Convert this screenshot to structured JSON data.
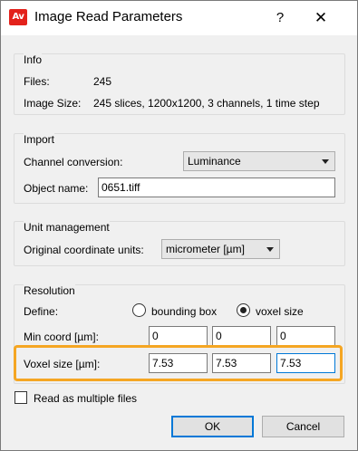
{
  "window": {
    "title": "Image Read Parameters",
    "app_icon_text": "Av",
    "help_glyph": "?",
    "close_glyph": "✕"
  },
  "info": {
    "title": "Info",
    "files_label": "Files:",
    "files_value": "245",
    "image_size_label": "Image Size:",
    "image_size_value": "245 slices, 1200x1200, 3 channels, 1 time step"
  },
  "import": {
    "title": "Import",
    "channel_conversion_label": "Channel conversion:",
    "channel_conversion_value": "Luminance",
    "object_name_label": "Object name:",
    "object_name_value": "0651.tiff"
  },
  "unit_management": {
    "title": "Unit management",
    "original_units_label": "Original coordinate units:",
    "original_units_value": "micrometer [µm]"
  },
  "resolution": {
    "title": "Resolution",
    "define_label": "Define:",
    "options": [
      {
        "label": "bounding box",
        "selected": false
      },
      {
        "label": "voxel size",
        "selected": true
      }
    ],
    "min_coord_label": "Min coord [µm]:",
    "min_coord_values": [
      "0",
      "0",
      "0"
    ],
    "voxel_size_label": "Voxel size [µm]:",
    "voxel_size_values": [
      "7.53",
      "7.53",
      "7.53"
    ],
    "highlight_color": "#f5a623"
  },
  "read_multiple": {
    "label": "Read as multiple files",
    "checked": false
  },
  "buttons": {
    "ok": "OK",
    "cancel": "Cancel"
  }
}
